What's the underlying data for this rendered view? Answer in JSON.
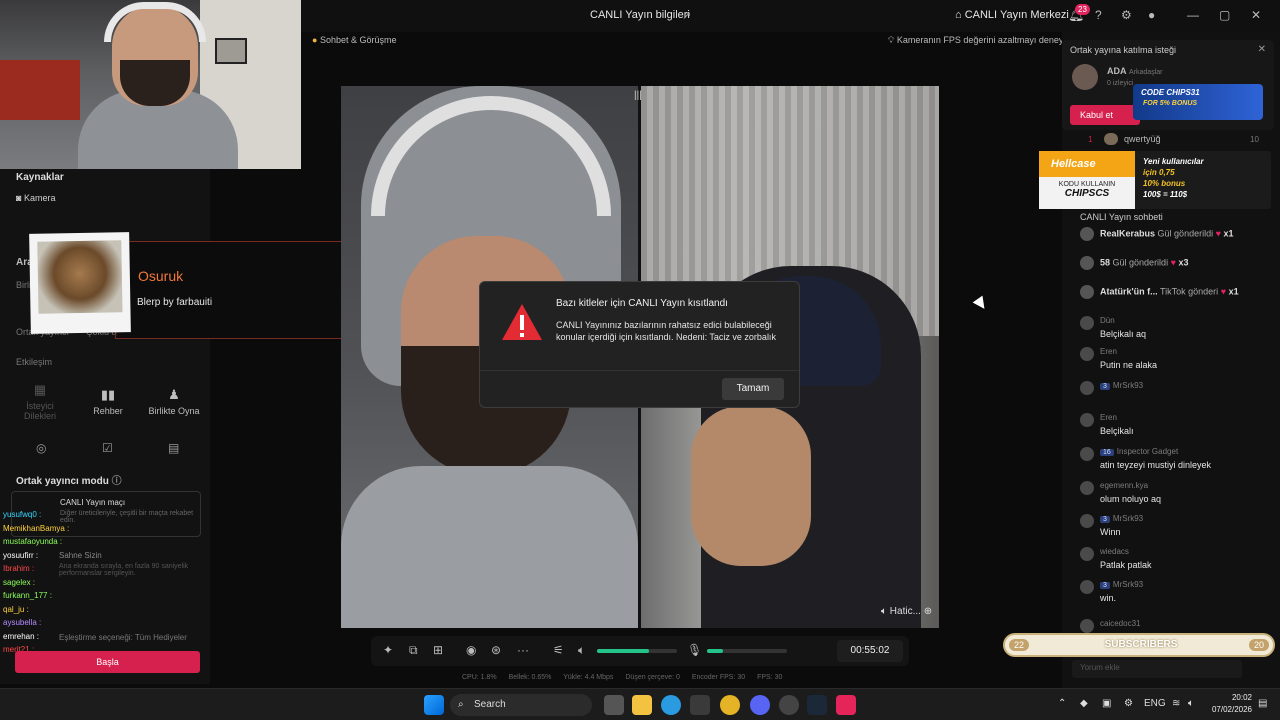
{
  "titlebar": {
    "center_title": "CANLI Yayın bilgileri",
    "home_label": "CANLI Yayın Merkezi",
    "notif_count": "23"
  },
  "subbar": {
    "left_label": "Sohbet & Görüşme",
    "right_label": "Kameranın FPS değerini azaltmayı deneyin"
  },
  "left_panel": {
    "sources_title": "Kaynaklar",
    "camera_label": "Kamera",
    "tools_title": "Ara",
    "tools_sub": "Birli",
    "cohost_label": "Ortak yayıncı",
    "cohost_label2": "Çoklu davet",
    "interaction_title": "Etkileşim",
    "btn_wishes": "İsteyici Dilekleri",
    "btn_guide": "Rehber",
    "btn_playtogether": "Birlikte Oyna",
    "cohost_mode_title": "Ortak yayıncı modu",
    "match_title": "CANLI Yayın maçı",
    "match_desc": "Diğer üreticileriyle, çeşitli bir maçta rekabet edin.",
    "stage_title": "Sahne Sizin",
    "stage_desc": "Ana ekranda sırayla, en fazla 90 saniyelik performanslar sergileyin.",
    "gift_option": "Eşleştirme seçeneği: Tüm Hediyeler",
    "start_label": "Başla"
  },
  "alert": {
    "name": "Osuruk",
    "sub": "Blerp by farbauiti"
  },
  "overlay_chat": [
    {
      "user": "yusufwq0 :",
      "color": "#33d6ff"
    },
    {
      "user": "MemikhanBamya :",
      "color": "#ffd23a"
    },
    {
      "user": "mustafaoyunda :",
      "color": "#8bff5a"
    },
    {
      "user": "yosuufirr :",
      "color": "#ffffff"
    },
    {
      "user": "Ibrahim :",
      "color": "#ff4747"
    },
    {
      "user": "sagelex :",
      "color": "#8bff5a"
    },
    {
      "user": "furkann_177 :",
      "color": "#8bff5a"
    },
    {
      "user": "qal_ju :",
      "color": "#ffd23a"
    },
    {
      "user": "aysubella :",
      "color": "#b58bff"
    },
    {
      "user": "emrehan :",
      "color": "#ffffff"
    },
    {
      "user": "merit21 :",
      "color": "#ff4747"
    }
  ],
  "video": {
    "right_label": "Hatic..."
  },
  "modal": {
    "title": "Bazı kitleler için CANLI Yayın kısıtlandı",
    "body": "CANLI Yayınınız bazılarının rahatsız edici bulabileceği konular içerdiği için kısıtlandı. Nedeni: Taciz ve zorbalık",
    "ok_label": "Tamam",
    "warning_icon": "warning-icon",
    "warning_color": "#e32b34"
  },
  "controls": {
    "timer": "00:55:02",
    "volume_level": 0.65,
    "mic_level": 0.2
  },
  "stats": {
    "cpu": "CPU: 1.8%",
    "memory": "Bellek: 0.65%",
    "upload": "Yükle: 4.4 Mbps",
    "dropped": "Düşen çerçeve: 0",
    "encoder_fps": "Encoder FPS: 30",
    "fps": "FPS: 30"
  },
  "right_panel": {
    "request_title": "Ortak yayına katılma isteği",
    "request_name": "ADA",
    "request_tag": "Arkadaşlar",
    "request_meta": "0 izleyici",
    "accept_label": "Kabul et",
    "rank_user": "qwertyüğ",
    "rank_num": "1",
    "rank_score": "10",
    "promo1_line1": "CODE CHIPS31",
    "promo1_line2": "FOR 5% BONUS",
    "promo2_logo": "Hellcase",
    "promo2_code_label": "KODU KULLANIN",
    "promo2_code": "CHIPSCS",
    "promo2_line1": "Yeni kullanıcılar",
    "promo2_line2": "için 0,75",
    "promo2_line3": "10% bonus",
    "promo2_line4": "100$ = 110$",
    "chat_title": "CANLI Yayın sohbeti",
    "gifts": [
      {
        "name": "RealKerabus",
        "action": "Gül gönderildi",
        "count": "x1"
      },
      {
        "name": "58",
        "action": "Gül gönderildi",
        "count": "x3"
      },
      {
        "name": "Atatürk'ün f...",
        "action": "TikTok gönderi",
        "count": "x1"
      }
    ],
    "messages": [
      {
        "user": "Dün",
        "text": "Belçikalı aq"
      },
      {
        "user": "Eren",
        "text": "Putin ne alaka"
      },
      {
        "user": "MrSrk93",
        "text": "",
        "lvl": "3"
      },
      {
        "user": "Eren",
        "text": "Belçikalı"
      },
      {
        "user": "Inspector Gadget",
        "text": "atin teyzeyi mustiyi dinleyek",
        "lvl": "16"
      },
      {
        "user": "egemenn.kya",
        "text": "olum noluyo aq"
      },
      {
        "user": "MrSrk93",
        "text": "Winn",
        "lvl": "3"
      },
      {
        "user": "wiedacs",
        "text": "Patlak patlak"
      },
      {
        "user": "MrSrk93",
        "text": "win.",
        "lvl": "3"
      },
      {
        "user": "caicedoc31",
        "text": "katıldı"
      }
    ],
    "sub_left": "22",
    "sub_label": "SUBSCRIBERS",
    "sub_right": "20",
    "chat_placeholder": "Yorum ekle"
  },
  "taskbar": {
    "search_label": "Search",
    "lang": "ENG",
    "time": "20:02",
    "date": "07/02/2026"
  }
}
